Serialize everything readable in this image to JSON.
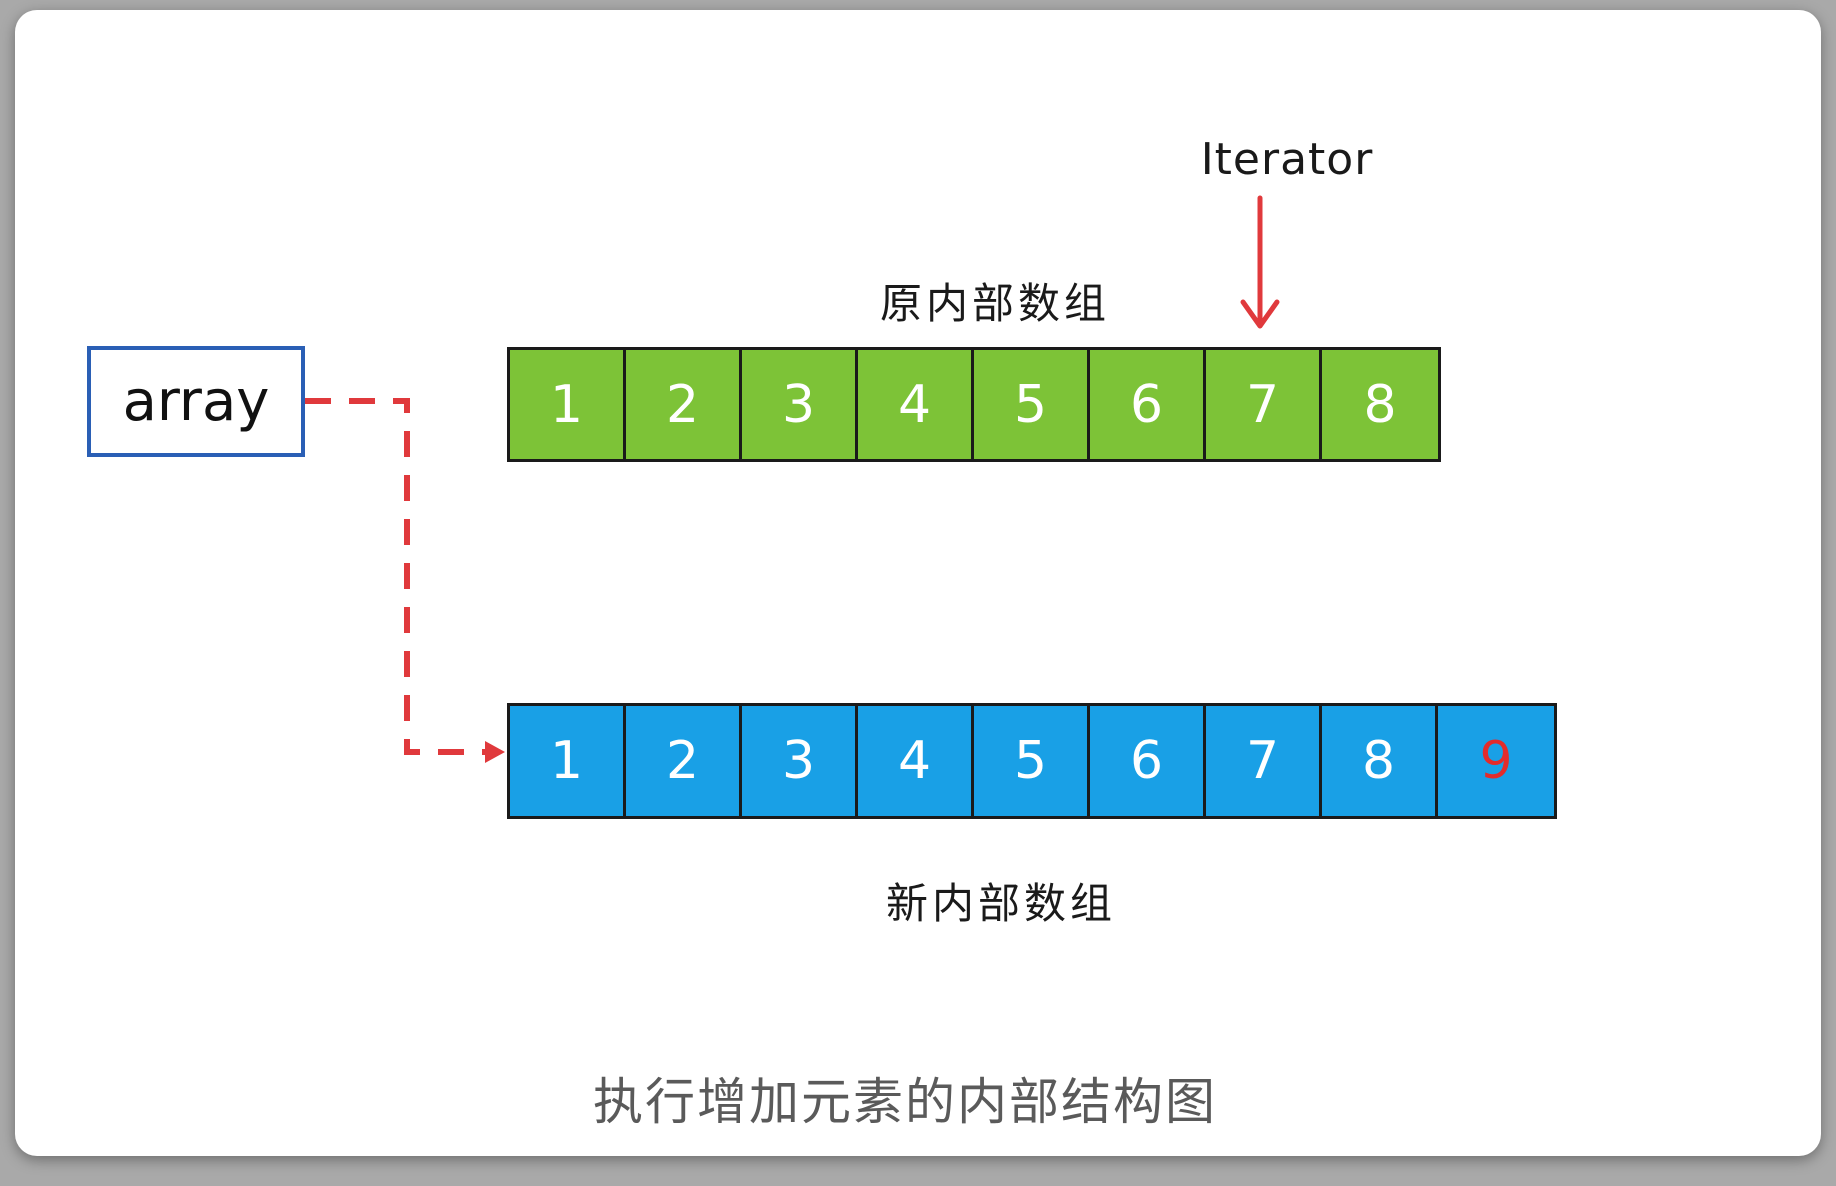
{
  "iterator_label": "Iterator",
  "original_array": {
    "label": "原内部数组",
    "values": [
      "1",
      "2",
      "3",
      "4",
      "5",
      "6",
      "7",
      "8"
    ],
    "color": "#7dc337"
  },
  "new_array": {
    "label": "新内部数组",
    "values": [
      "1",
      "2",
      "3",
      "4",
      "5",
      "6",
      "7",
      "8",
      "9"
    ],
    "color": "#19a0e6",
    "highlight_value": "9",
    "highlight_color": "#e32b2b"
  },
  "reference": {
    "label": "array",
    "border_color": "#2a5fb5",
    "arrow_color": "#e0393c"
  },
  "caption": "执行增加元素的内部结构图"
}
